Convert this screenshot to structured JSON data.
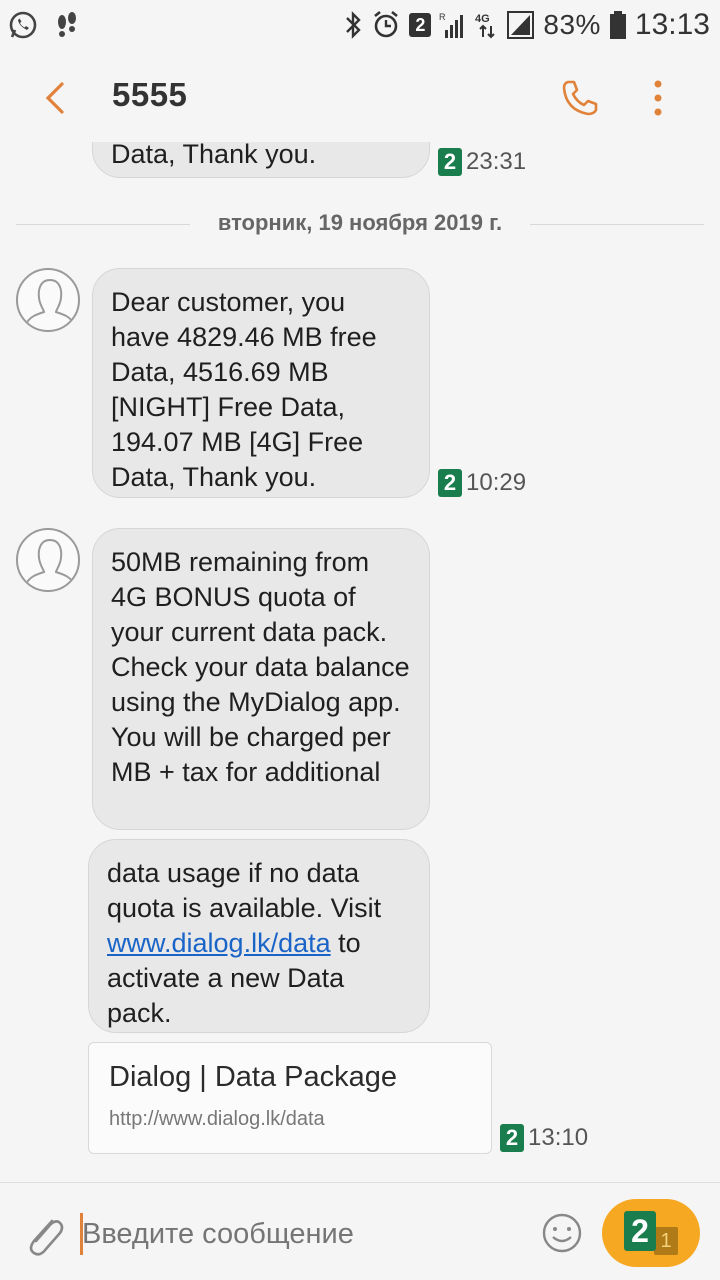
{
  "status_bar": {
    "sim_badge": "2",
    "battery_percent": "83%",
    "time": "13:13"
  },
  "header": {
    "title": "5555"
  },
  "date_separator": "вторник, 19 ноября 2019 г.",
  "messages": [
    {
      "text": "Data, Thank you.",
      "sim": "2",
      "time": "23:31"
    },
    {
      "text": "Dear customer, you have  4829.46 MB free Data, 4516.69 MB [NIGHT] Free Data, 194.07 MB [4G] Free Data, Thank you.",
      "sim": "2",
      "time": "10:29"
    },
    {
      "text": "50MB remaining from 4G BONUS quota of your current data pack. Check your data balance using the MyDialog app. You will be charged per MB + tax for additional"
    },
    {
      "text_before": " data usage if no data quota is available. Visit ",
      "link": "www.dialog.lk/data",
      "text_after": " to activate a new Data pack."
    }
  ],
  "link_preview": {
    "title": "Dialog | Data Package",
    "url": "http://www.dialog.lk/data",
    "sim": "2",
    "time": "13:10"
  },
  "composer": {
    "placeholder": "Введите сообщение",
    "send_sim": "2",
    "send_sub": "1"
  },
  "colors": {
    "accent": "#f7a823",
    "sim_green": "#1a7d4e",
    "link": "#1a64c8"
  }
}
